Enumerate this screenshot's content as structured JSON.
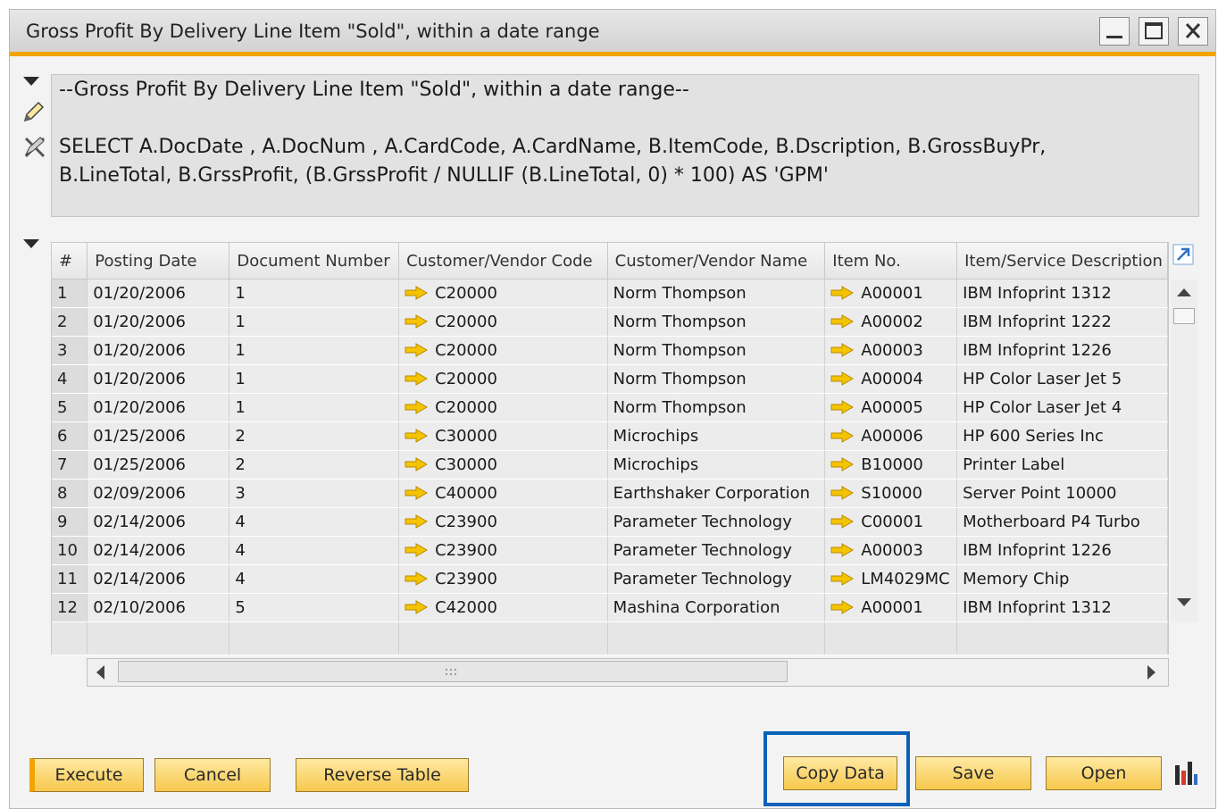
{
  "window": {
    "title": "Gross Profit By Delivery Line Item \"Sold\",  within a date range"
  },
  "query": {
    "line1": "--Gross Profit By Delivery Line Item \"Sold\",  within a date range--",
    "line2": "SELECT A.DocDate , A.DocNum , A.CardCode, A.CardName, B.ItemCode, B.Dscription, B.GrossBuyPr,",
    "line3": "B.LineTotal, B.GrssProfit, (B.GrssProfit / NULLIF (B.LineTotal, 0) * 100) AS 'GPM'"
  },
  "grid": {
    "columns": [
      "#",
      "Posting Date",
      "Document Number",
      "Customer/Vendor Code",
      "Customer/Vendor Name",
      "Item No.",
      "Item/Service Description"
    ],
    "rows": [
      {
        "n": "1",
        "date": "01/20/2006",
        "doc": "1",
        "code": "C20000",
        "name": "Norm Thompson",
        "item": "A00001",
        "desc": "IBM Infoprint 1312"
      },
      {
        "n": "2",
        "date": "01/20/2006",
        "doc": "1",
        "code": "C20000",
        "name": "Norm Thompson",
        "item": "A00002",
        "desc": "IBM Infoprint 1222"
      },
      {
        "n": "3",
        "date": "01/20/2006",
        "doc": "1",
        "code": "C20000",
        "name": "Norm Thompson",
        "item": "A00003",
        "desc": "IBM Infoprint 1226"
      },
      {
        "n": "4",
        "date": "01/20/2006",
        "doc": "1",
        "code": "C20000",
        "name": "Norm Thompson",
        "item": "A00004",
        "desc": "HP Color Laser Jet 5"
      },
      {
        "n": "5",
        "date": "01/20/2006",
        "doc": "1",
        "code": "C20000",
        "name": "Norm Thompson",
        "item": "A00005",
        "desc": "HP Color Laser Jet 4"
      },
      {
        "n": "6",
        "date": "01/25/2006",
        "doc": "2",
        "code": "C30000",
        "name": "Microchips",
        "item": "A00006",
        "desc": "HP 600 Series Inc"
      },
      {
        "n": "7",
        "date": "01/25/2006",
        "doc": "2",
        "code": "C30000",
        "name": "Microchips",
        "item": "B10000",
        "desc": "Printer Label"
      },
      {
        "n": "8",
        "date": "02/09/2006",
        "doc": "3",
        "code": "C40000",
        "name": "Earthshaker Corporation",
        "item": "S10000",
        "desc": "Server Point 10000"
      },
      {
        "n": "9",
        "date": "02/14/2006",
        "doc": "4",
        "code": "C23900",
        "name": "Parameter Technology",
        "item": "C00001",
        "desc": "Motherboard P4 Turbo"
      },
      {
        "n": "10",
        "date": "02/14/2006",
        "doc": "4",
        "code": "C23900",
        "name": "Parameter Technology",
        "item": "A00003",
        "desc": "IBM Infoprint 1226"
      },
      {
        "n": "11",
        "date": "02/14/2006",
        "doc": "4",
        "code": "C23900",
        "name": "Parameter Technology",
        "item": "LM4029MC",
        "desc": "Memory Chip"
      },
      {
        "n": "12",
        "date": "02/10/2006",
        "doc": "5",
        "code": "C42000",
        "name": "Mashina Corporation",
        "item": "A00001",
        "desc": "IBM Infoprint 1312"
      }
    ]
  },
  "buttons": {
    "execute": "Execute",
    "cancel": "Cancel",
    "reverse_table": "Reverse Table",
    "copy_data": "Copy Data",
    "save": "Save",
    "open": "Open"
  },
  "icons": {
    "link_arrow": "link-arrow-icon",
    "chart": "chart-icon"
  },
  "colors": {
    "accent_bar": "#f0a400",
    "button_fill": "#f7c84c",
    "highlight_box": "#0a63b8",
    "link_arrow": "#f5c400"
  }
}
